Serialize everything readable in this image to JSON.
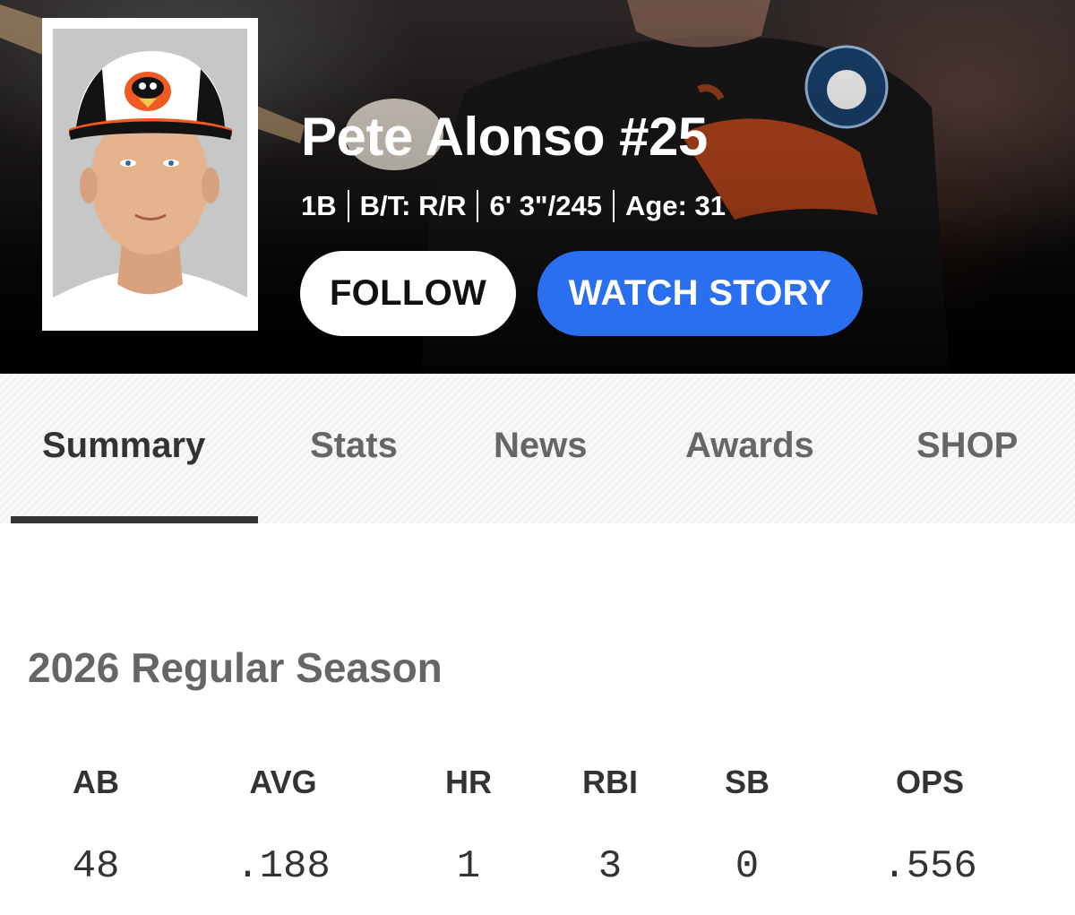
{
  "player": {
    "name": "Pete Alonso #25",
    "position": "1B",
    "bats_throws": "B/T: R/R",
    "height_weight": "6' 3\"/245",
    "age": "Age: 31"
  },
  "actions": {
    "follow_label": "FOLLOW",
    "watch_story_label": "WATCH STORY"
  },
  "tabs": [
    {
      "label": "Summary",
      "active": true
    },
    {
      "label": "Stats",
      "active": false
    },
    {
      "label": "News",
      "active": false
    },
    {
      "label": "Awards",
      "active": false
    },
    {
      "label": "SHOP",
      "active": false
    }
  ],
  "season": {
    "title": "2026 Regular Season",
    "stats": [
      {
        "label": "AB",
        "value": "48"
      },
      {
        "label": "AVG",
        "value": ".188"
      },
      {
        "label": "HR",
        "value": "1"
      },
      {
        "label": "RBI",
        "value": "3"
      },
      {
        "label": "SB",
        "value": "0"
      },
      {
        "label": "OPS",
        "value": ".556"
      }
    ]
  },
  "colors": {
    "watch_button": "#2a6ff0",
    "team_orange": "#f15a22",
    "tab_underline": "#333333"
  },
  "icons": {
    "headshot": "player-headshot",
    "hero_background": "player-action-photo"
  }
}
